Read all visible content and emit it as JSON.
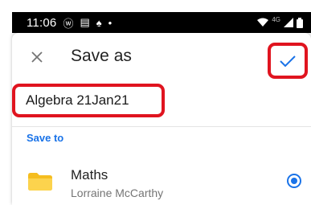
{
  "status_bar": {
    "time": "11:06",
    "network_label": "4G"
  },
  "dialog": {
    "title": "Save as",
    "file_name": "Algebra 21Jan21",
    "section_label": "Save to",
    "accent_color": "#1a73e8",
    "highlight_color": "#e0141f"
  },
  "folder": {
    "name": "Maths",
    "owner": "Lorraine McCarthy",
    "selected": true
  },
  "icons": {
    "close": "close-icon",
    "confirm": "check-icon",
    "folder": "folder-icon"
  }
}
